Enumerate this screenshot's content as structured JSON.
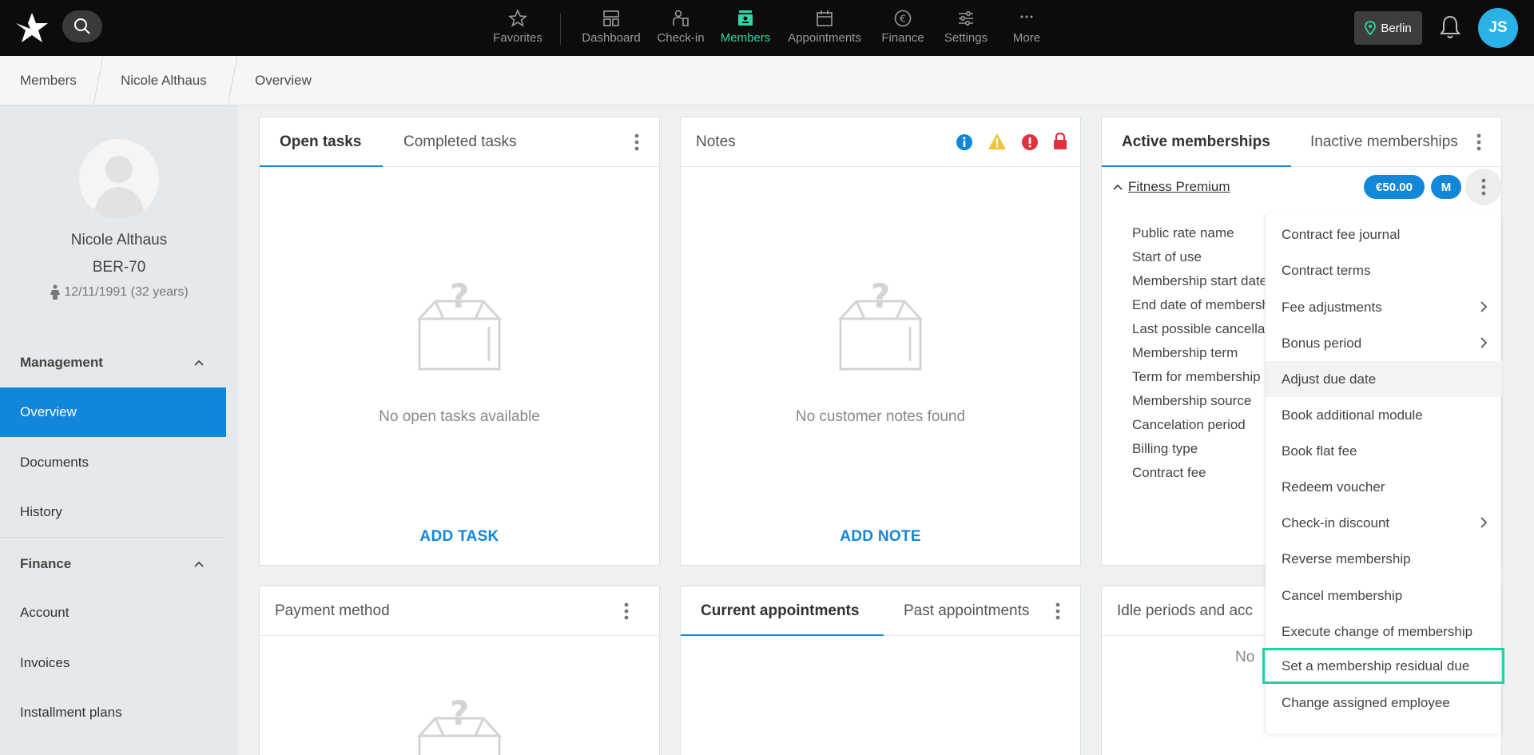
{
  "topbar": {
    "nav": [
      {
        "label": "Favorites",
        "icon": "star-icon"
      },
      {
        "label": "Dashboard",
        "icon": "dashboard-icon"
      },
      {
        "label": "Check-in",
        "icon": "check-in-icon"
      },
      {
        "label": "Members",
        "icon": "members-icon",
        "active": true
      },
      {
        "label": "Appointments",
        "icon": "calendar-icon"
      },
      {
        "label": "Finance",
        "icon": "euro-icon"
      },
      {
        "label": "Settings",
        "icon": "sliders-icon"
      },
      {
        "label": "More",
        "icon": "more-icon"
      }
    ],
    "location": "Berlin",
    "user_initials": "JS"
  },
  "breadcrumb": [
    "Members",
    "Nicole Althaus",
    "Overview"
  ],
  "profile": {
    "name": "Nicole Althaus",
    "id": "BER-70",
    "dob": "12/11/1991 (32 years)"
  },
  "sidebar": {
    "management_label": "Management",
    "management_items": [
      "Overview",
      "Documents",
      "History"
    ],
    "finance_label": "Finance",
    "finance_items": [
      "Account",
      "Invoices",
      "Installment plans"
    ]
  },
  "tasks_card": {
    "tabs": [
      "Open tasks",
      "Completed tasks"
    ],
    "empty": "No open tasks available",
    "action": "ADD TASK"
  },
  "notes_card": {
    "title": "Notes",
    "empty": "No customer notes found",
    "action": "ADD NOTE"
  },
  "memberships_card": {
    "tabs": [
      "Active memberships",
      "Inactive memberships"
    ],
    "membership_name": "Fitness Premium",
    "price": "€50.00",
    "period_badge": "M",
    "detail_labels": [
      "Public rate name",
      "Start of use",
      "Membership start date",
      "End date of membership",
      "Last possible cancellation",
      "Membership term",
      "Term for membership",
      "Membership source",
      "Cancelation period",
      "Billing type",
      "Contract fee"
    ]
  },
  "payment_card": {
    "title": "Payment method"
  },
  "appointments_card": {
    "tabs": [
      "Current appointments",
      "Past appointments"
    ]
  },
  "idle_card": {
    "title": "Idle periods and acc",
    "empty": "No"
  },
  "menu": {
    "items": [
      {
        "label": "Contract fee journal"
      },
      {
        "label": "Contract terms"
      },
      {
        "label": "Fee adjustments",
        "submenu": true
      },
      {
        "label": "Bonus period",
        "submenu": true
      },
      {
        "label": "Adjust due date",
        "hover": true
      },
      {
        "label": "Book additional module"
      },
      {
        "label": "Book flat fee"
      },
      {
        "label": "Redeem voucher"
      },
      {
        "label": "Check-in discount",
        "submenu": true
      },
      {
        "label": "Reverse membership"
      },
      {
        "label": "Cancel membership"
      },
      {
        "label": "Execute change of membership"
      },
      {
        "label": "Set a membership residual due",
        "highlight": true
      },
      {
        "label": "Change assigned employee"
      }
    ]
  },
  "colors": {
    "accent": "#1286d8",
    "active_nav": "#2fd6a6",
    "highlight": "#1fd2a8",
    "info": "#1286d8",
    "warning": "#f2c037",
    "danger": "#e0313f"
  }
}
